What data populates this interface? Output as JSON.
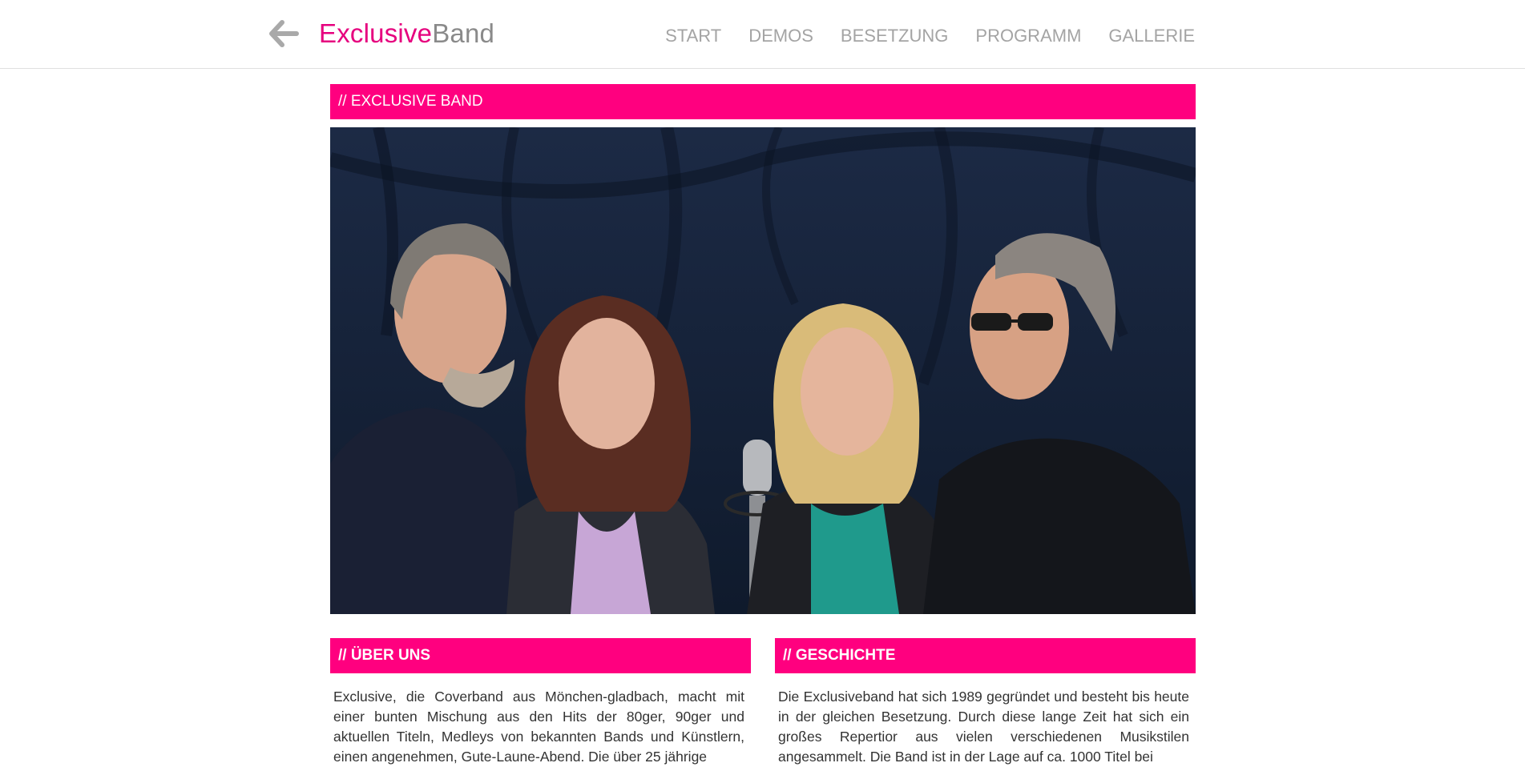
{
  "brand": {
    "name_part1": "Exclusive",
    "name_part2": "Band"
  },
  "nav": {
    "items": [
      "START",
      "DEMOS",
      "BESETZUNG",
      "PROGRAMM",
      "GALLERIE"
    ]
  },
  "hero": {
    "title": "// EXCLUSIVE BAND",
    "photo": "band-photo"
  },
  "about": {
    "title": "// ÜBER UNS",
    "text": "Exclusive, die Coverband aus Mönchen-gladbach, macht mit einer bunten Mischung aus den Hits der 80ger, 90ger und aktuellen Titeln, Medleys von bekannten Bands und Künstlern, einen angenehmen, Gute-Laune-Abend. Die über 25 jährige"
  },
  "history": {
    "title": "// GESCHICHTE",
    "text": "Die Exclusiveband hat sich 1989 gegründet und besteht bis heute in der gleichen Besetzung. Durch diese lange Zeit hat sich ein großes Repertior aus vielen verschiedenen Musikstilen angesammelt. Die Band ist in der Lage auf ca. 1000 Titel bei"
  },
  "colors": {
    "accent": "#ff007f",
    "brand_pink": "#e6007e",
    "nav_text": "#a4a4a4"
  },
  "icons": {
    "back": "arrow-left-icon"
  }
}
